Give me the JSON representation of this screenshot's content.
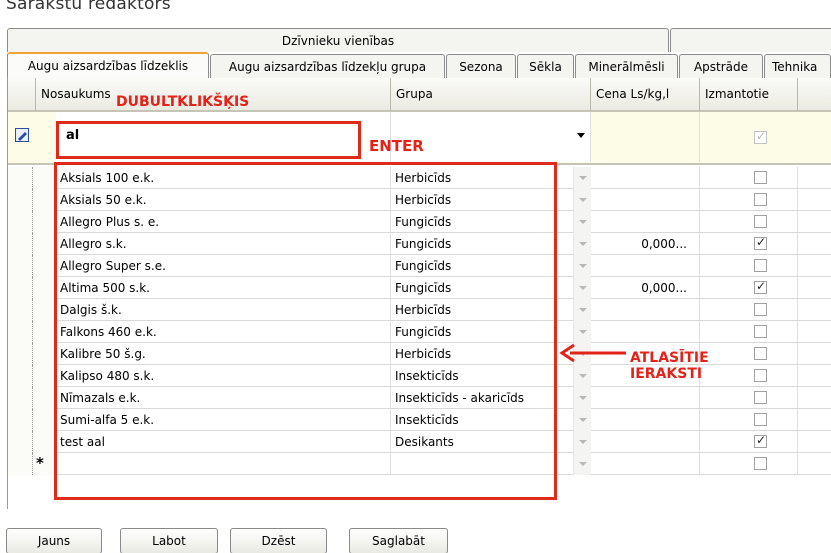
{
  "window": {
    "title": "Sarakstu redaktors"
  },
  "tabs": {
    "row1": [
      {
        "label": "Dzīvnieku vienības"
      },
      {
        "label": ""
      }
    ],
    "row2": [
      {
        "label": "Augu aizsardzības līdzeklis",
        "active": true
      },
      {
        "label": "Augu aizsardzības līdzekļu grupa"
      },
      {
        "label": "Sezona"
      },
      {
        "label": "Sēkla"
      },
      {
        "label": "Minerālmēsli"
      },
      {
        "label": "Apstrāde"
      },
      {
        "label": "Tehnika"
      }
    ]
  },
  "grid": {
    "columns": [
      "Nosaukums",
      "Grupa",
      "Cena Ls/kg,l",
      "Izmantotie"
    ],
    "edit_row": {
      "name": "al",
      "group": "",
      "price": "",
      "used": true
    },
    "rows": [
      {
        "name": "Aksials 100 e.k.",
        "group": "Herbicīds",
        "price": "",
        "used": false
      },
      {
        "name": "Aksials 50 e.k.",
        "group": "Herbicīds",
        "price": "",
        "used": false
      },
      {
        "name": "Allegro Plus s. e.",
        "group": "Fungicīds",
        "price": "",
        "used": false
      },
      {
        "name": "Allegro s.k.",
        "group": "Fungicīds",
        "price": "0,000...",
        "used": true
      },
      {
        "name": "Allegro Super s.e.",
        "group": "Fungicīds",
        "price": "",
        "used": false
      },
      {
        "name": "Altima 500 s.k.",
        "group": "Fungicīds",
        "price": "0,000...",
        "used": true
      },
      {
        "name": "Dalgis š.k.",
        "group": "Herbicīds",
        "price": "",
        "used": false
      },
      {
        "name": "Falkons 460 e.k.",
        "group": "Fungicīds",
        "price": "",
        "used": false
      },
      {
        "name": "Kalibre 50 š.g.",
        "group": "Herbicīds",
        "price": "",
        "used": false
      },
      {
        "name": "Kalipso 480 s.k.",
        "group": "Insekticīds",
        "price": "",
        "used": false
      },
      {
        "name": "Nīmazals e.k.",
        "group": "Insekticīds - akaricīds",
        "price": "",
        "used": false
      },
      {
        "name": "Sumi-alfa 5 e.k.",
        "group": "Insekticīds",
        "price": "",
        "used": false
      },
      {
        "name": "test aal",
        "group": "Desikants",
        "price": "",
        "used": true
      }
    ],
    "new_row_marker": "*"
  },
  "annotations": {
    "dblclick": "DUBULTKLIKŠĶIS",
    "enter": "ENTER",
    "selected_line1": "ATLASĪTIE",
    "selected_line2": "IERAKSTI"
  },
  "buttons": {
    "new": "Jauns",
    "edit": "Labot",
    "delete": "Dzēst",
    "save": "Saglabāt"
  },
  "colors": {
    "annotation": "#e12b1a",
    "active_tab_accent": "#f1a235",
    "edit_row_bg": "#fdfce6"
  }
}
